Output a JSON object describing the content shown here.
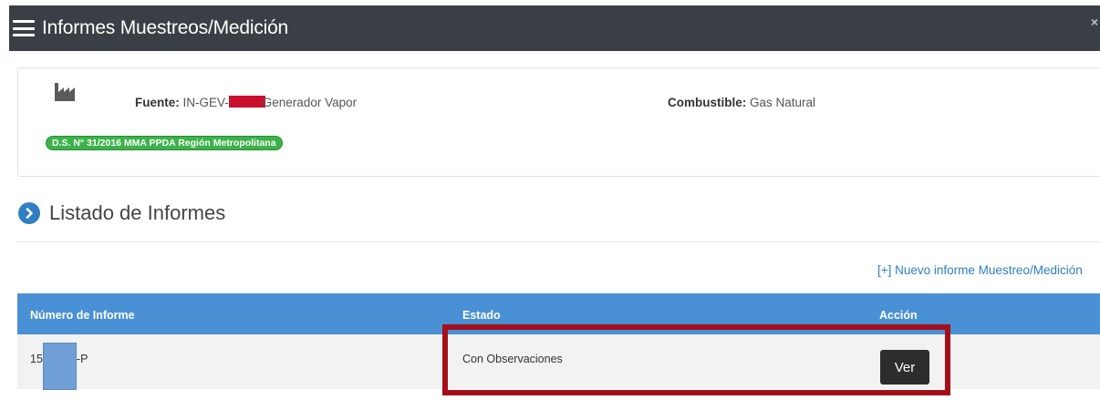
{
  "window": {
    "title": "Informes Muestreos/Medición",
    "close_label": "×"
  },
  "source": {
    "fuente_label": "Fuente:",
    "fuente_prefix": "IN-GEV-",
    "fuente_suffix": "Generador Vapor",
    "combustible_label": "Combustible:",
    "combustible_value": "Gas Natural",
    "badge": "D.S. N° 31/2016 MMA PPDA Región Metropolitana"
  },
  "section": {
    "title": "Listado de Informes"
  },
  "actions": {
    "new_report": "[+] Nuevo informe Muestreo/Medición"
  },
  "table": {
    "headers": [
      "Número de Informe",
      "Estado",
      "Acción"
    ],
    "rows": [
      {
        "numero_prefix": "15",
        "numero_suffix": "-P",
        "estado": "Con Observaciones",
        "accion": "Ver"
      }
    ]
  },
  "colors": {
    "header": "#3a3f45",
    "table_header": "#4a90d4",
    "badge": "#3cb34a",
    "highlight": "#a50f1a"
  }
}
